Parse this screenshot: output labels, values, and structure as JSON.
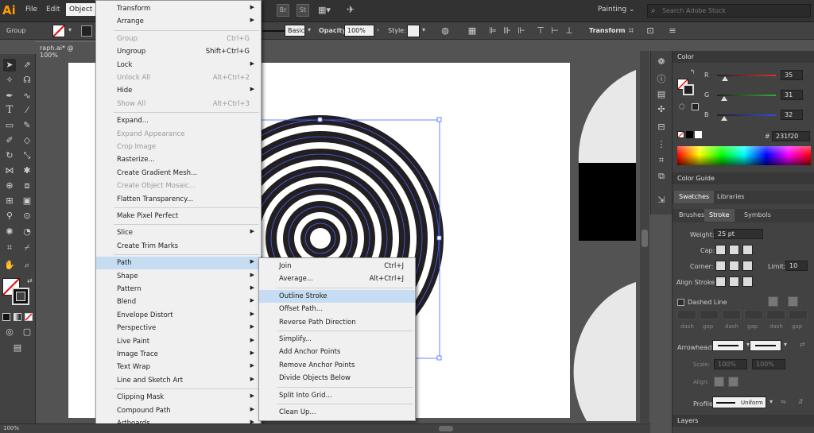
{
  "app": {
    "logo": "Ai"
  },
  "menubar": {
    "items": [
      "File",
      "Edit",
      "Object"
    ],
    "active": "Object"
  },
  "toolbar_top": {
    "bridge": "Br",
    "stock": "St"
  },
  "workspace": {
    "label": "Painting",
    "chevron": "⌄"
  },
  "search": {
    "placeholder": "Search Adobe Stock"
  },
  "control_bar": {
    "selection_type": "Group",
    "stroke_style": "Basic",
    "opacity_label": "Opacity:",
    "opacity_value": "100%",
    "style_label": "Style:",
    "transform_label": "Transform"
  },
  "document": {
    "tab_title": "raph.ai* @ 100%"
  },
  "status_bar": {
    "zoom": "100%"
  },
  "object_menu": {
    "items": [
      {
        "label": "Transform",
        "submenu": true
      },
      {
        "label": "Arrange",
        "submenu": true
      },
      {
        "sep": true
      },
      {
        "label": "Group",
        "shortcut": "Ctrl+G",
        "disabled": true
      },
      {
        "label": "Ungroup",
        "shortcut": "Shift+Ctrl+G"
      },
      {
        "label": "Lock",
        "submenu": true
      },
      {
        "label": "Unlock All",
        "shortcut": "Alt+Ctrl+2",
        "disabled": true
      },
      {
        "label": "Hide",
        "submenu": true
      },
      {
        "label": "Show All",
        "shortcut": "Alt+Ctrl+3",
        "disabled": true
      },
      {
        "sep": true
      },
      {
        "label": "Expand..."
      },
      {
        "label": "Expand Appearance",
        "disabled": true
      },
      {
        "label": "Crop Image",
        "disabled": true
      },
      {
        "label": "Rasterize..."
      },
      {
        "label": "Create Gradient Mesh..."
      },
      {
        "label": "Create Object Mosaic...",
        "disabled": true
      },
      {
        "label": "Flatten Transparency..."
      },
      {
        "sep": true
      },
      {
        "label": "Make Pixel Perfect"
      },
      {
        "sep": true
      },
      {
        "label": "Slice",
        "submenu": true
      },
      {
        "label": "Create Trim Marks"
      },
      {
        "sep": true
      },
      {
        "label": "Path",
        "submenu": true,
        "highlighted": true
      },
      {
        "label": "Shape",
        "submenu": true
      },
      {
        "label": "Pattern",
        "submenu": true
      },
      {
        "label": "Blend",
        "submenu": true
      },
      {
        "label": "Envelope Distort",
        "submenu": true
      },
      {
        "label": "Perspective",
        "submenu": true
      },
      {
        "label": "Live Paint",
        "submenu": true
      },
      {
        "label": "Image Trace",
        "submenu": true
      },
      {
        "label": "Text Wrap",
        "submenu": true
      },
      {
        "label": "Line and Sketch Art",
        "submenu": true
      },
      {
        "sep": true
      },
      {
        "label": "Clipping Mask",
        "submenu": true
      },
      {
        "label": "Compound Path",
        "submenu": true
      },
      {
        "label": "Artboards",
        "submenu": true
      }
    ]
  },
  "path_submenu": {
    "items": [
      {
        "label": "Join",
        "shortcut": "Ctrl+J"
      },
      {
        "label": "Average...",
        "shortcut": "Alt+Ctrl+J"
      },
      {
        "sep": true
      },
      {
        "label": "Outline Stroke",
        "highlighted": true
      },
      {
        "label": "Offset Path..."
      },
      {
        "label": "Reverse Path Direction"
      },
      {
        "sep": true
      },
      {
        "label": "Simplify..."
      },
      {
        "label": "Add Anchor Points"
      },
      {
        "label": "Remove Anchor Points"
      },
      {
        "label": "Divide Objects Below"
      },
      {
        "sep": true
      },
      {
        "label": "Split Into Grid..."
      },
      {
        "sep": true
      },
      {
        "label": "Clean Up..."
      }
    ]
  },
  "color_panel": {
    "title": "Color",
    "channels": [
      {
        "name": "R",
        "value": "35",
        "fraction": 0.137,
        "color": "#e03030"
      },
      {
        "name": "G",
        "value": "31",
        "fraction": 0.122,
        "color": "#30b030"
      },
      {
        "name": "B",
        "value": "32",
        "fraction": 0.125,
        "color": "#3050e0"
      }
    ],
    "hex_prefix": "#",
    "hex": "231f20"
  },
  "color_guide": {
    "title": "Color Guide"
  },
  "swatches_tabs": [
    "Swatches",
    "Libraries"
  ],
  "stroke_tabs": [
    "Brushes",
    "Stroke",
    "Symbols"
  ],
  "stroke_panel": {
    "weight_label": "Weight:",
    "weight_value": "25 pt",
    "cap_label": "Cap:",
    "corner_label": "Corner:",
    "limit_label": "Limit:",
    "limit_value": "10",
    "align_label": "Align Stroke:",
    "dashed_label": "Dashed Line",
    "dash_fields": [
      "dash",
      "gap",
      "dash",
      "gap",
      "dash",
      "gap"
    ],
    "arrowheads_label": "Arrowheads:",
    "scale_label": "Scale:",
    "scale_values": [
      "100%",
      "100%"
    ],
    "align_label2": "Align:",
    "profile_label": "Profile:",
    "profile_value": "Uniform"
  },
  "layers": {
    "title": "Layers"
  },
  "colors": {
    "accent": "#c6dcf2",
    "arrow": "#e0202a",
    "ink": "#231f20",
    "ring_path": "#4466ff"
  }
}
